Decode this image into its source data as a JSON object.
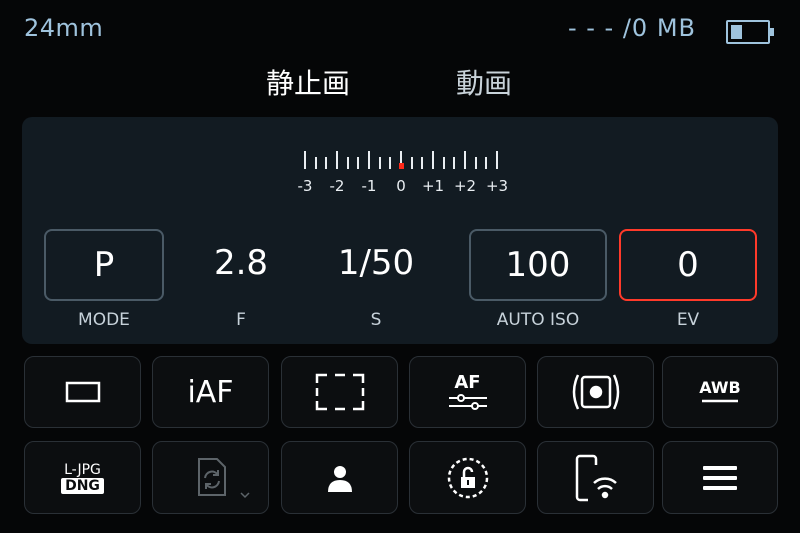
{
  "status": {
    "focal_length": "24mm",
    "storage": "- - -  /0 MB",
    "battery_level": 0.3
  },
  "tabs": {
    "still": "静止画",
    "video": "動画",
    "active": "静止画"
  },
  "exposure_scale": {
    "labels": [
      "-3",
      "-2",
      "-1",
      "0",
      "+1",
      "+2",
      "+3"
    ],
    "current_value": 0
  },
  "params": {
    "mode": {
      "value": "P",
      "label": "MODE"
    },
    "aperture": {
      "value": "2.8",
      "label": "F"
    },
    "shutter": {
      "value": "1/50",
      "label": "S"
    },
    "iso": {
      "value": "100",
      "label": "AUTO ISO"
    },
    "ev": {
      "value": "0",
      "label": "EV"
    }
  },
  "tiles": {
    "af_mode_text": "iAF",
    "af_settings_text": "AF",
    "wb_text": "AWB",
    "format_line1": "L-JPG",
    "format_line2": "DNG"
  },
  "colors": {
    "accent_blue": "#9fc3dd",
    "ev_highlight": "#ff3a2a",
    "panel": "#121b22"
  }
}
